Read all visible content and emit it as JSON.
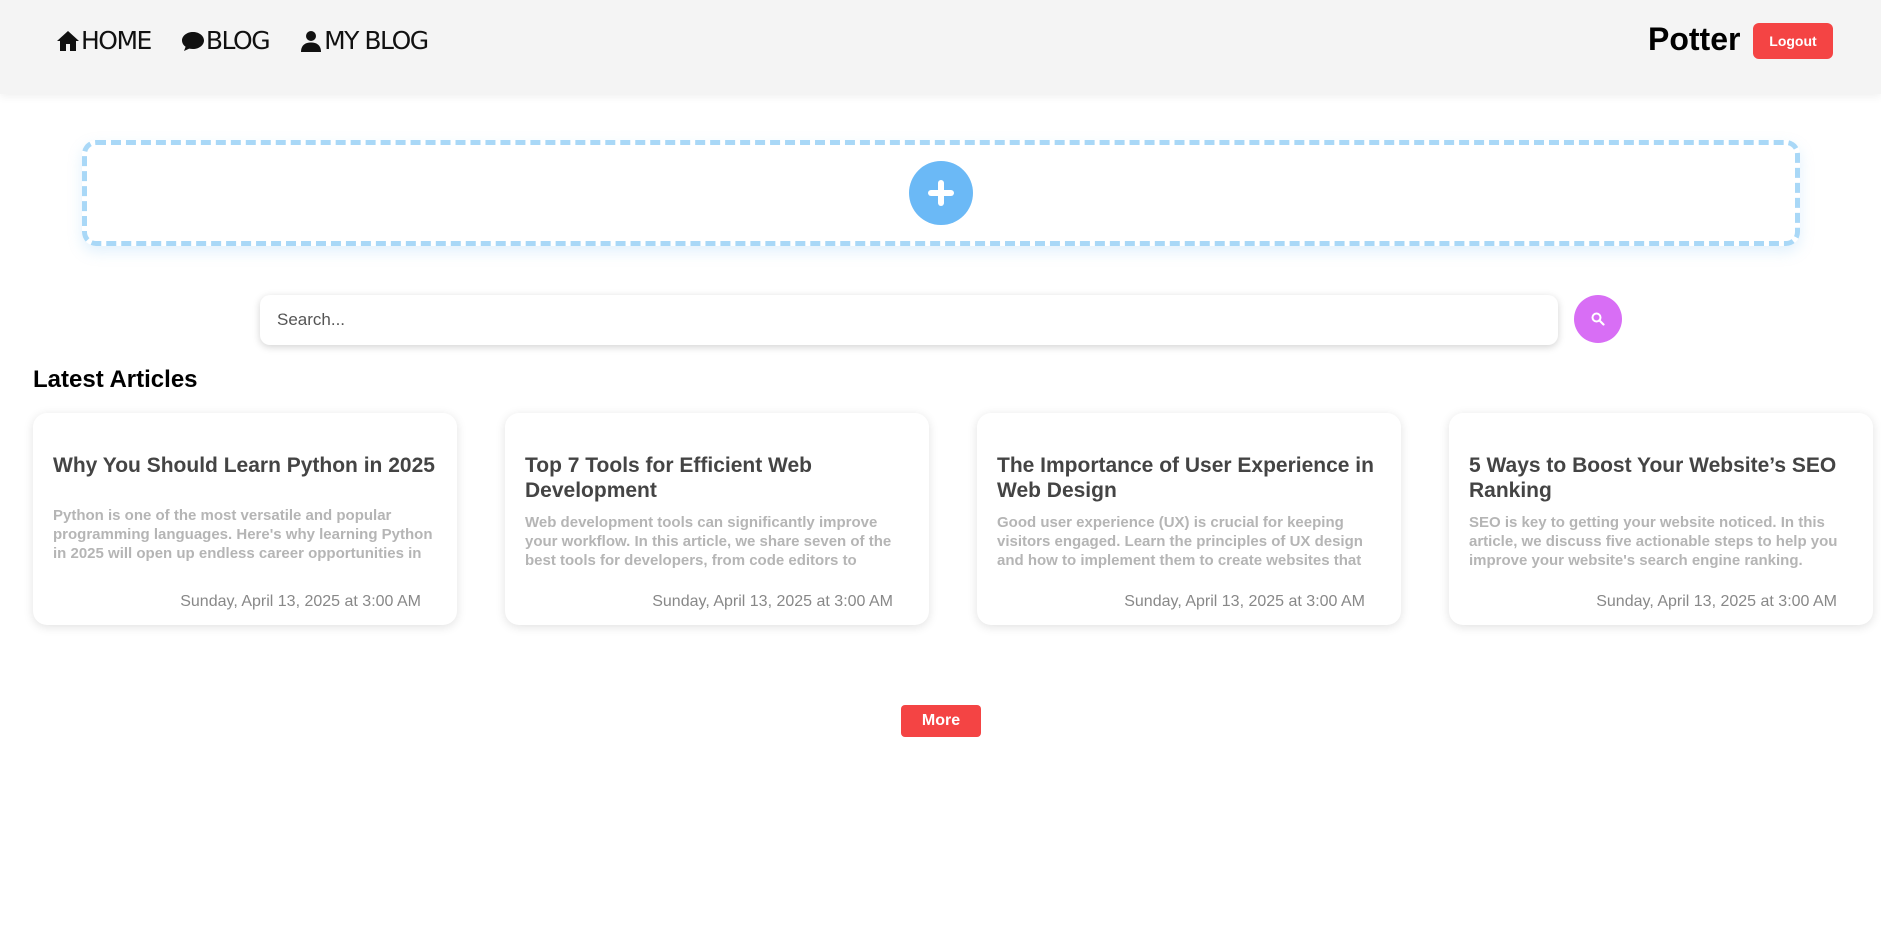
{
  "nav": {
    "items": [
      {
        "label": "HOME",
        "icon": "home-icon"
      },
      {
        "label": "BLOG",
        "icon": "comment-icon"
      },
      {
        "label": "MY BLOG",
        "icon": "user-icon"
      }
    ]
  },
  "user": {
    "name": "Potter",
    "logout_label": "Logout"
  },
  "add_area": {
    "icon": "plus-icon"
  },
  "search": {
    "placeholder": "Search...",
    "icon": "search-icon"
  },
  "articles": {
    "section_title": "Latest Articles",
    "items": [
      {
        "title": "Why You Should Learn Python in 2025",
        "excerpt": "Python is one of the most versatile and popular programming languages. Here's why learning Python in 2025 will open up endless career opportunities in",
        "date": "Sunday, April 13, 2025 at 3:00 AM"
      },
      {
        "title": "Top 7 Tools for Efficient Web Development",
        "excerpt": "Web development tools can significantly improve your workflow. In this article, we share seven of the best tools for developers, from code editors to",
        "date": "Sunday, April 13, 2025 at 3:00 AM"
      },
      {
        "title": "The Importance of User Experience in Web Design",
        "excerpt": "Good user experience (UX) is crucial for keeping visitors engaged. Learn the principles of UX design and how to implement them to create websites that",
        "date": "Sunday, April 13, 2025 at 3:00 AM"
      },
      {
        "title": "5 Ways to Boost Your Website’s SEO Ranking",
        "excerpt": "SEO is key to getting your website noticed. In this article, we discuss five actionable steps to help you improve your website's search engine ranking.",
        "date": "Sunday, April 13, 2025 at 3:00 AM"
      }
    ],
    "more_label": "More"
  },
  "colors": {
    "accent_red": "#f44444",
    "add_blue": "#6bb9f6",
    "search_purple": "#d86ef5"
  }
}
